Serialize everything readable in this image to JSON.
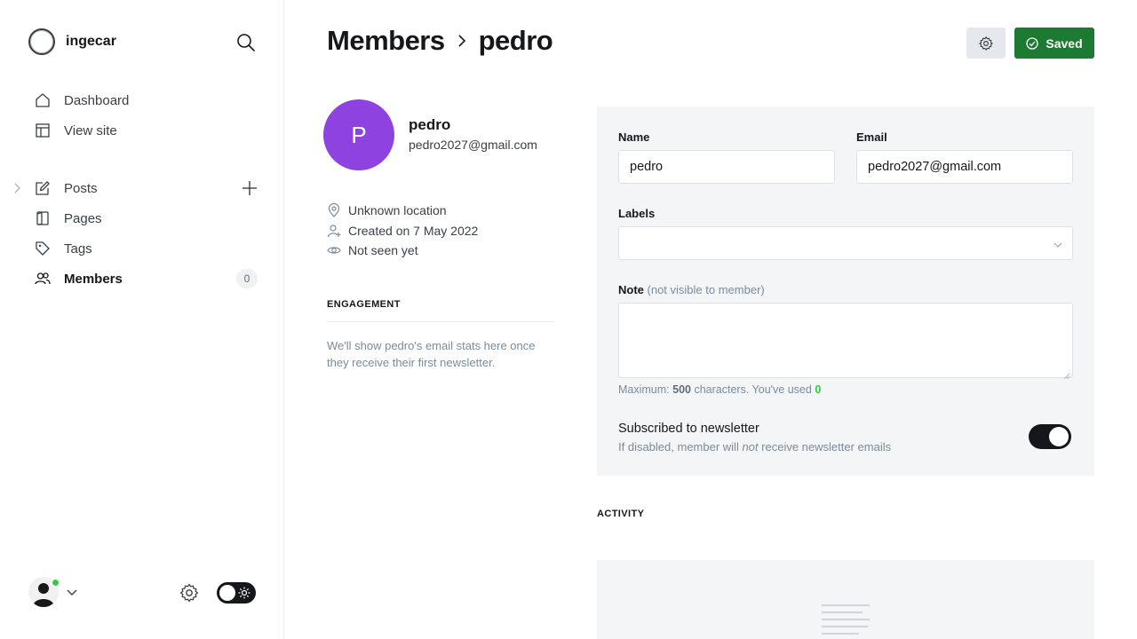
{
  "sidebar": {
    "site_name": "ingecar",
    "nav_top": [
      {
        "label": "Dashboard",
        "icon": "home-icon"
      },
      {
        "label": "View site",
        "icon": "layout-icon"
      }
    ],
    "nav_main": [
      {
        "label": "Posts",
        "icon": "edit-icon"
      },
      {
        "label": "Pages",
        "icon": "page-icon"
      },
      {
        "label": "Tags",
        "icon": "tag-icon"
      },
      {
        "label": "Members",
        "icon": "members-icon",
        "count": "0",
        "active": true
      }
    ]
  },
  "header": {
    "breadcrumb_parent": "Members",
    "breadcrumb_current": "pedro",
    "saved_label": "Saved"
  },
  "member": {
    "initial": "P",
    "name": "pedro",
    "email": "pedro2027@gmail.com",
    "location": "Unknown location",
    "created": "Created on 7 May 2022",
    "last_seen": "Not seen yet",
    "avatar_color": "#8e42e0"
  },
  "engagement": {
    "title": "ENGAGEMENT",
    "text": "We'll show pedro's email stats here once they receive their first newsletter."
  },
  "form": {
    "name_label": "Name",
    "name_value": "pedro",
    "email_label": "Email",
    "email_value": "pedro2027@gmail.com",
    "labels_label": "Labels",
    "note_label": "Note",
    "note_sub": "(not visible to member)",
    "note_value": "",
    "hint_prefix": "Maximum:",
    "hint_max": "500",
    "hint_mid": "characters. You've used",
    "hint_used": "0",
    "newsletter_title": "Subscribed to newsletter",
    "newsletter_desc_a": "If disabled, member will",
    "newsletter_desc_em": "not",
    "newsletter_desc_b": "receive newsletter emails",
    "newsletter_enabled": true
  },
  "activity": {
    "title": "ACTIVITY"
  },
  "colors": {
    "accent_green": "#1c7a32",
    "online_dot": "#30cf43",
    "toggle_dark": "#15171a"
  }
}
